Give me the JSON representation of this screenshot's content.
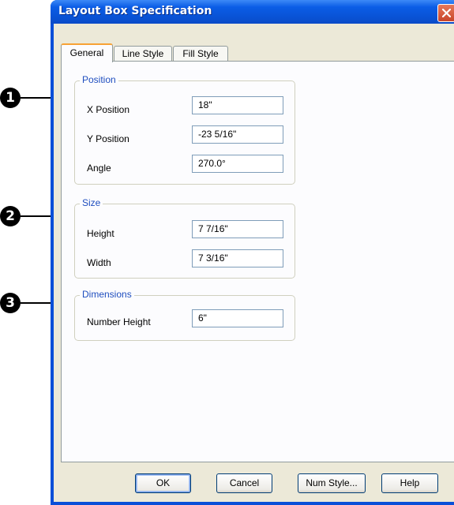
{
  "window": {
    "title": "Layout Box Specification",
    "close_glyph": "close-icon"
  },
  "tabs": [
    {
      "label": "General",
      "active": true
    },
    {
      "label": "Line Style",
      "active": false
    },
    {
      "label": "Fill Style",
      "active": false
    }
  ],
  "position": {
    "legend": "Position",
    "x_label": "X Position",
    "x_value": "18\"",
    "y_label": "Y Position",
    "y_value": "-23 5/16\"",
    "angle_label": "Angle",
    "angle_value": "270.0°"
  },
  "size": {
    "legend": "Size",
    "height_label": "Height",
    "height_value": "7 7/16\"",
    "width_label": "Width",
    "width_value": "7 3/16\""
  },
  "dimensions": {
    "legend": "Dimensions",
    "number_height_label": "Number Height",
    "number_height_value": "6\""
  },
  "buttons": {
    "ok": "OK",
    "cancel": "Cancel",
    "num_style": "Num Style...",
    "help": "Help"
  },
  "callouts": [
    "1",
    "2",
    "3"
  ],
  "colors": {
    "title_bar": "#0a4fd8",
    "group_label": "#1f4ebf",
    "dialog_face": "#ece9d8",
    "tab_highlight": "#f7a234"
  }
}
